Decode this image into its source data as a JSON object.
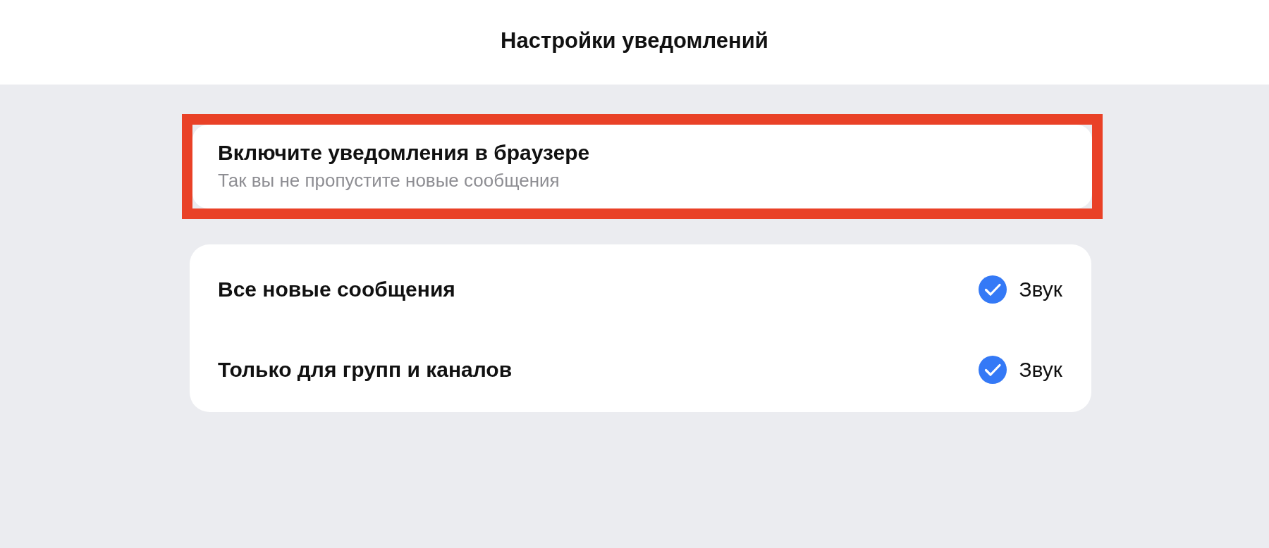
{
  "header": {
    "title": "Настройки уведомлений"
  },
  "browser_banner": {
    "title": "Включите уведомления в браузере",
    "subtitle": "Так вы не пропустите новые сообщения",
    "highlighted": true
  },
  "settings": [
    {
      "label": "Все новые сообщения",
      "sound": {
        "label": "Звук",
        "checked": true
      }
    },
    {
      "label": "Только для групп и каналов",
      "sound": {
        "label": "Звук",
        "checked": true
      }
    }
  ]
}
